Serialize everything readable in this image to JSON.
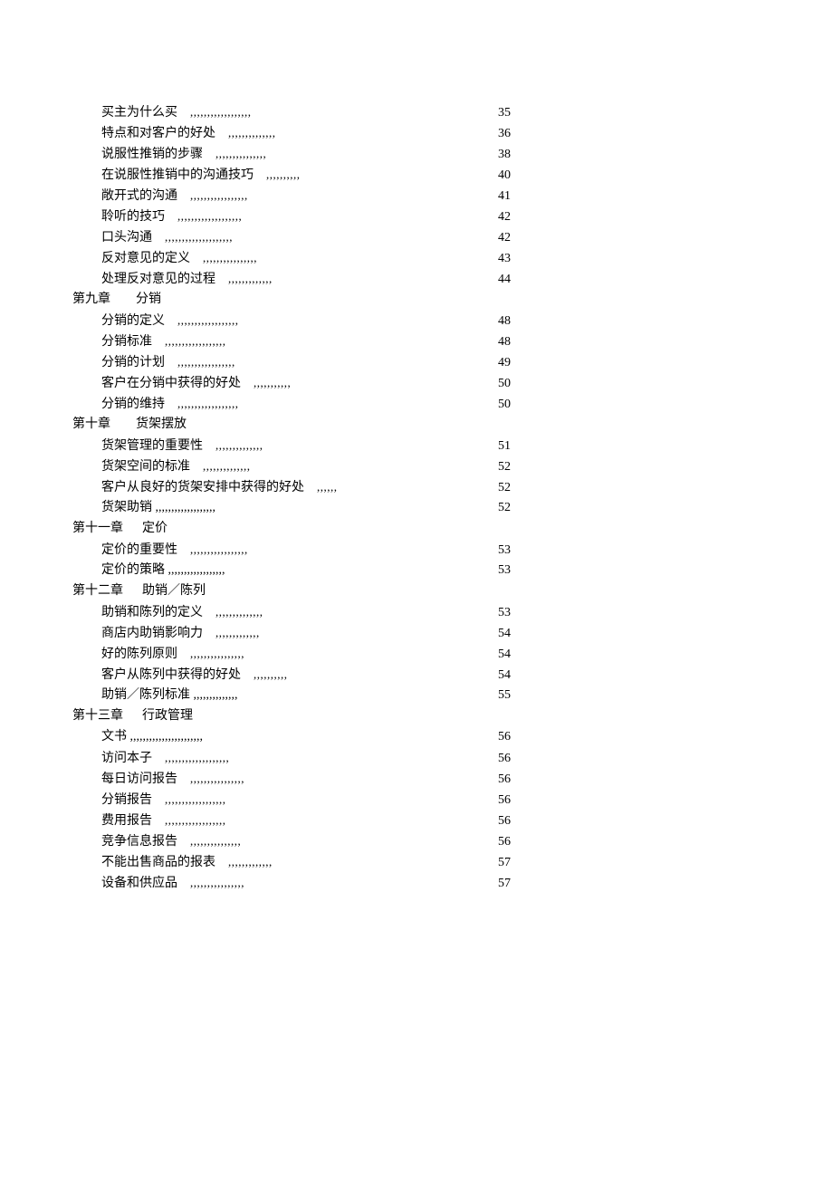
{
  "toc": [
    {
      "type": "entry",
      "title": "买主为什么买",
      "leader": ",,,,,,,,,,,,,,,,,,",
      "page": "35"
    },
    {
      "type": "entry",
      "title": "特点和对客户的好处",
      "leader": ",,,,,,,,,,,,,,",
      "page": "36"
    },
    {
      "type": "entry",
      "title": "说服性推销的步骤",
      "leader": ",,,,,,,,,,,,,,,",
      "page": "38"
    },
    {
      "type": "entry",
      "title": "在说服性推销中的沟通技巧",
      "leader": ",,,,,,,,,,",
      "page": "40"
    },
    {
      "type": "entry",
      "title": "敞开式的沟通",
      "leader": ",,,,,,,,,,,,,,,,,",
      "page": "41"
    },
    {
      "type": "entry",
      "title": "聆听的技巧",
      "leader": ",,,,,,,,,,,,,,,,,,,",
      "page": "42"
    },
    {
      "type": "entry",
      "title": "口头沟通",
      "leader": ",,,,,,,,,,,,,,,,,,,,",
      "page": "42"
    },
    {
      "type": "entry",
      "title": "反对意见的定义",
      "leader": ",,,,,,,,,,,,,,,,",
      "page": "43"
    },
    {
      "type": "entry",
      "title": "处理反对意见的过程",
      "leader": ",,,,,,,,,,,,,",
      "page": "44"
    },
    {
      "type": "chapter",
      "title": "第九章        分销"
    },
    {
      "type": "entry",
      "title": "分销的定义",
      "leader": ",,,,,,,,,,,,,,,,,,",
      "page": "48"
    },
    {
      "type": "entry",
      "title": "分销标准",
      "leader": ",,,,,,,,,,,,,,,,,,",
      "page": "48"
    },
    {
      "type": "entry",
      "title": "分销的计划",
      "leader": ",,,,,,,,,,,,,,,,,",
      "page": "49"
    },
    {
      "type": "entry",
      "title": "客户在分销中获得的好处",
      "leader": ",,,,,,,,,,,",
      "page": "50"
    },
    {
      "type": "entry",
      "title": "分销的维持",
      "leader": ",,,,,,,,,,,,,,,,,,",
      "page": "50"
    },
    {
      "type": "chapter",
      "title": "第十章        货架摆放"
    },
    {
      "type": "entry",
      "title": "货架管理的重要性",
      "leader": ",,,,,,,,,,,,,,",
      "page": "51"
    },
    {
      "type": "entry",
      "title": "货架空间的标准",
      "leader": ",,,,,,,,,,,,,,",
      "page": "52"
    },
    {
      "type": "entry",
      "title": "客户从良好的货架安排中获得的好处",
      "leader": ",,,,,,",
      "page": "52"
    },
    {
      "type": "entry",
      "title": "货架助销 ,,,,,,,,,,,,,,,,,,,",
      "leader": "",
      "page": "52"
    },
    {
      "type": "chapter",
      "title": "第十一章      定价"
    },
    {
      "type": "entry",
      "title": "定价的重要性",
      "leader": ",,,,,,,,,,,,,,,,,",
      "page": "53"
    },
    {
      "type": "entry",
      "title": "定价的策略 ,,,,,,,,,,,,,,,,,,",
      "leader": "",
      "page": "53"
    },
    {
      "type": "chapter",
      "title": "第十二章      助销／陈列"
    },
    {
      "type": "entry",
      "title": "助销和陈列的定义",
      "leader": ",,,,,,,,,,,,,,",
      "page": "53"
    },
    {
      "type": "entry",
      "title": "商店内助销影响力",
      "leader": ",,,,,,,,,,,,,",
      "page": "54"
    },
    {
      "type": "entry",
      "title": "好的陈列原则",
      "leader": ",,,,,,,,,,,,,,,,",
      "page": "54"
    },
    {
      "type": "entry",
      "title": "客户从陈列中获得的好处",
      "leader": ",,,,,,,,,,",
      "page": "54"
    },
    {
      "type": "entry",
      "title": "助销／陈列标准 ,,,,,,,,,,,,,,",
      "leader": "",
      "page": "55"
    },
    {
      "type": "chapter",
      "title": "第十三章      行政管理"
    },
    {
      "type": "entry",
      "title": "文书 ,,,,,,,,,,,,,,,,,,,,,,,",
      "leader": "",
      "page": "56"
    },
    {
      "type": "entry",
      "title": "访问本子",
      "leader": ",,,,,,,,,,,,,,,,,,,",
      "page": "56"
    },
    {
      "type": "entry",
      "title": "每日访问报告",
      "leader": ",,,,,,,,,,,,,,,,",
      "page": "56"
    },
    {
      "type": "entry",
      "title": "分销报告",
      "leader": ",,,,,,,,,,,,,,,,,,",
      "page": "56"
    },
    {
      "type": "entry",
      "title": "费用报告",
      "leader": ",,,,,,,,,,,,,,,,,,",
      "page": "56"
    },
    {
      "type": "entry",
      "title": "竞争信息报告",
      "leader": ",,,,,,,,,,,,,,,",
      "page": "56"
    },
    {
      "type": "entry",
      "title": "不能出售商品的报表",
      "leader": ",,,,,,,,,,,,,",
      "page": "57"
    },
    {
      "type": "entry",
      "title": "设备和供应品",
      "leader": ",,,,,,,,,,,,,,,,",
      "page": "57"
    }
  ]
}
